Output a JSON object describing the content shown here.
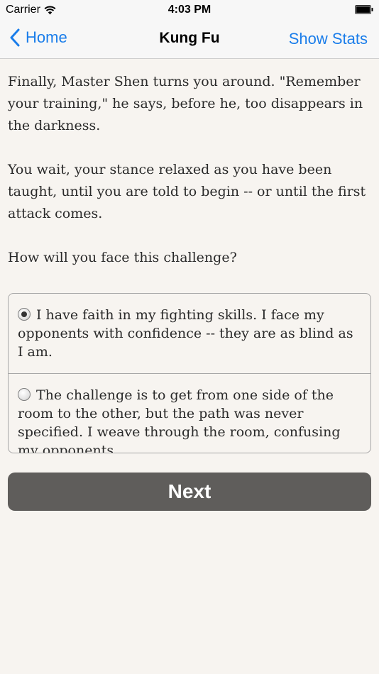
{
  "status_bar": {
    "carrier": "Carrier",
    "time": "4:03 PM"
  },
  "nav": {
    "back_label": "Home",
    "title": "Kung Fu",
    "right_label": "Show Stats"
  },
  "story": {
    "paragraphs": [
      "Finally, Master Shen turns you around. \"Remember your training,\" he says, before he, too disappears in the darkness.",
      "You wait, your stance relaxed as you have been taught, until you are told to begin -- or until the first attack comes.",
      "How will you face this challenge?"
    ]
  },
  "choices": [
    {
      "text": "I have faith in my fighting skills. I face my opponents with confidence -- they are as blind as I am.",
      "selected": true
    },
    {
      "text": "The challenge is to get from one side of the room to the other, but the path was never specified. I weave through the room, confusing my opponents.",
      "selected": false
    }
  ],
  "next_label": "Next"
}
